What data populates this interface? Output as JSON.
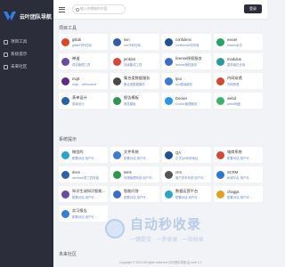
{
  "brand": {
    "name": "云叶团队导航"
  },
  "nav": [
    {
      "label": "项目工具"
    },
    {
      "label": "系统提示"
    },
    {
      "label": "未来社区"
    }
  ],
  "topbar": {
    "search_placeholder": "输入你想搜的内容",
    "login_label": "登录"
  },
  "sections": [
    {
      "title": "项目工具"
    },
    {
      "title": "系统提示"
    },
    {
      "title": "未来社区"
    }
  ],
  "cards_group1": [
    {
      "name": "gitlab",
      "desc": "gitlab代码仓库",
      "icon": "gitlab-icon",
      "color": "#e24329"
    },
    {
      "name": "svn",
      "desc": "svn代码仓库",
      "icon": "svn-icon",
      "color": "#2f5fa8"
    },
    {
      "name": "confulenc",
      "desc": "confluence知识库",
      "icon": "confluence-icon",
      "color": "#1f4f9e"
    },
    {
      "name": "nexus",
      "desc": "maven私仓",
      "icon": "nexus-icon",
      "color": "#29a36a"
    },
    {
      "name": "禅道",
      "desc": "项目管理工具",
      "icon": "zentao-icon",
      "color": "#6a4aa0"
    },
    {
      "name": "jenkins",
      "desc": "持续集成工具",
      "icon": "jenkins-icon",
      "color": "#d24939"
    },
    {
      "name": "license授权服务",
      "desc": "license授权服务",
      "icon": "license-icon",
      "color": "#3a6ccf"
    },
    {
      "name": "modulus",
      "desc": "整体组件仓库",
      "icon": "modulus-icon",
      "color": "#2a9a9a"
    },
    {
      "name": "mqtt",
      "desc": "mqtt， websocket",
      "icon": "mqtt-icon",
      "color": "#5b2d86"
    },
    {
      "name": "集合类数据服务",
      "desc": "集合类数据服务",
      "icon": "dataset-icon",
      "color": "#4a4a4a"
    },
    {
      "name": "tpui",
      "desc": "tpui基础服务",
      "icon": "tpui-icon",
      "color": "#3a7bd5"
    },
    {
      "name": "内网穿透",
      "desc": "内网穿透",
      "icon": "tunnel-icon",
      "color": "#cf4a2a"
    },
    {
      "name": "表单设计",
      "desc": "表单设计",
      "icon": "form-icon",
      "color": "#2f5fa8"
    },
    {
      "name": "报告模板",
      "desc": "报告模板",
      "icon": "report-icon",
      "color": "#2a9a4a"
    },
    {
      "name": "Docker",
      "desc": "Docker管理服务",
      "icon": "docker-icon",
      "color": "#2496ed"
    },
    {
      "name": "webd",
      "desc": "webd网盘",
      "icon": "webd-icon",
      "color": "#3bb36a"
    }
  ],
  "cards_group2": [
    {
      "name": "微信的",
      "desc": "配置对话 用户可...",
      "icon": "wechat-icon",
      "color": "#2ba4c9"
    },
    {
      "name": "文件系统",
      "desc": "配置对话 用户可...",
      "icon": "file-icon",
      "color": "#3a7bd5"
    },
    {
      "name": "QA",
      "desc": "正式QA系统地址",
      "icon": "qa-icon",
      "color": "#1f4f9e"
    },
    {
      "name": "电商系统",
      "desc": "配置对话 用户可...",
      "icon": "shop-icon",
      "color": "#d24939"
    },
    {
      "name": "docs",
      "desc": "windows类工具安装",
      "icon": "docs-icon",
      "color": "#2f5fa8"
    },
    {
      "name": "wms",
      "desc": "仓储管理系统 用户可...",
      "icon": "wms-icon",
      "color": "#2a9a4a"
    },
    {
      "name": "crm",
      "desc": "客户关系系统 用户可...",
      "icon": "crm-icon",
      "color": "#555555"
    },
    {
      "name": "SCRM",
      "desc": "私域平台 用户可...",
      "icon": "scrm-icon",
      "color": "#2a7ad5"
    },
    {
      "name": "知识生成知识智能...",
      "desc": "配置对话 用户可...",
      "icon": "kb-icon",
      "color": "#6a4aa0"
    },
    {
      "name": "智能问答",
      "desc": "配置对话 用户可...",
      "icon": "qa-bot-icon",
      "color": "#3a6ccf"
    },
    {
      "name": "数据运营平台",
      "desc": "配置对话 用户可...",
      "icon": "data-icon",
      "color": "#2ba4c9"
    },
    {
      "name": "chaggs",
      "desc": "配置对话 用户可...",
      "icon": "chaggs-icon",
      "color": "#e0a020"
    },
    {
      "name": "实习报告",
      "desc": "配置对话 用户可...",
      "icon": "intern-icon",
      "color": "#3a7bd5"
    }
  ],
  "footer": {
    "text": "Copyright © 2023 All rights reserved 云叶团队导航 由 web 1.0"
  },
  "watermark": {
    "main": "自动秒收录",
    "sub": "一键提交 · 一步收录 · 一站收录"
  }
}
